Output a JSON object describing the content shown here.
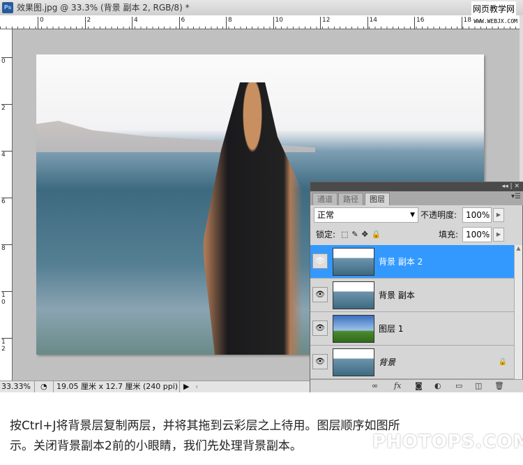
{
  "window": {
    "title": "效果图.jpg @ 33.3% (背景 副本 2, RGB/8) *",
    "watermark_top": "网页教学网",
    "watermark_url": "WWW.WEBJX.COM"
  },
  "ruler": {
    "h_ticks": [
      "0",
      "2",
      "4",
      "6",
      "8",
      "10",
      "12",
      "14",
      "16",
      "18"
    ],
    "v_ticks": [
      "0",
      "2",
      "4",
      "6",
      "8",
      "1 0",
      "1 2"
    ]
  },
  "status": {
    "zoom": "33.33%",
    "doc_info": "19.05 厘米 x 12.7 厘米 (240 ppi)"
  },
  "panel": {
    "tabs": [
      "通道",
      "路径",
      "图层"
    ],
    "active_tab": "图层",
    "blend_mode": "正常",
    "opacity_label": "不透明度:",
    "opacity": "100%",
    "lock_label": "锁定:",
    "fill_label": "填充:",
    "fill": "100%",
    "layers": [
      {
        "name": "背景 副本 2",
        "selected": true,
        "visible": true
      },
      {
        "name": "背景 副本",
        "selected": false,
        "visible": true
      },
      {
        "name": "图层 1",
        "selected": false,
        "visible": true
      },
      {
        "name": "背景",
        "selected": false,
        "visible": true,
        "locked": true
      }
    ],
    "tools": [
      "link-icon",
      "fx",
      "mask-icon",
      "adjustment-icon",
      "group-icon",
      "new-layer-icon",
      "trash-icon"
    ],
    "fx_label": "fx"
  },
  "caption": [
    "按Ctrl+J将背景层复制两层，并将其拖到云彩层之上待用。图层顺序如图所",
    "示。关闭背景副本2前的小眼睛，我们先处理背景副本。"
  ],
  "watermark_bottom": "PHOTOPS.COM",
  "colors": {
    "selection": "#3399ff",
    "panel_bg": "#d6d6d6",
    "canvas_bg": "#c0c0c0"
  }
}
